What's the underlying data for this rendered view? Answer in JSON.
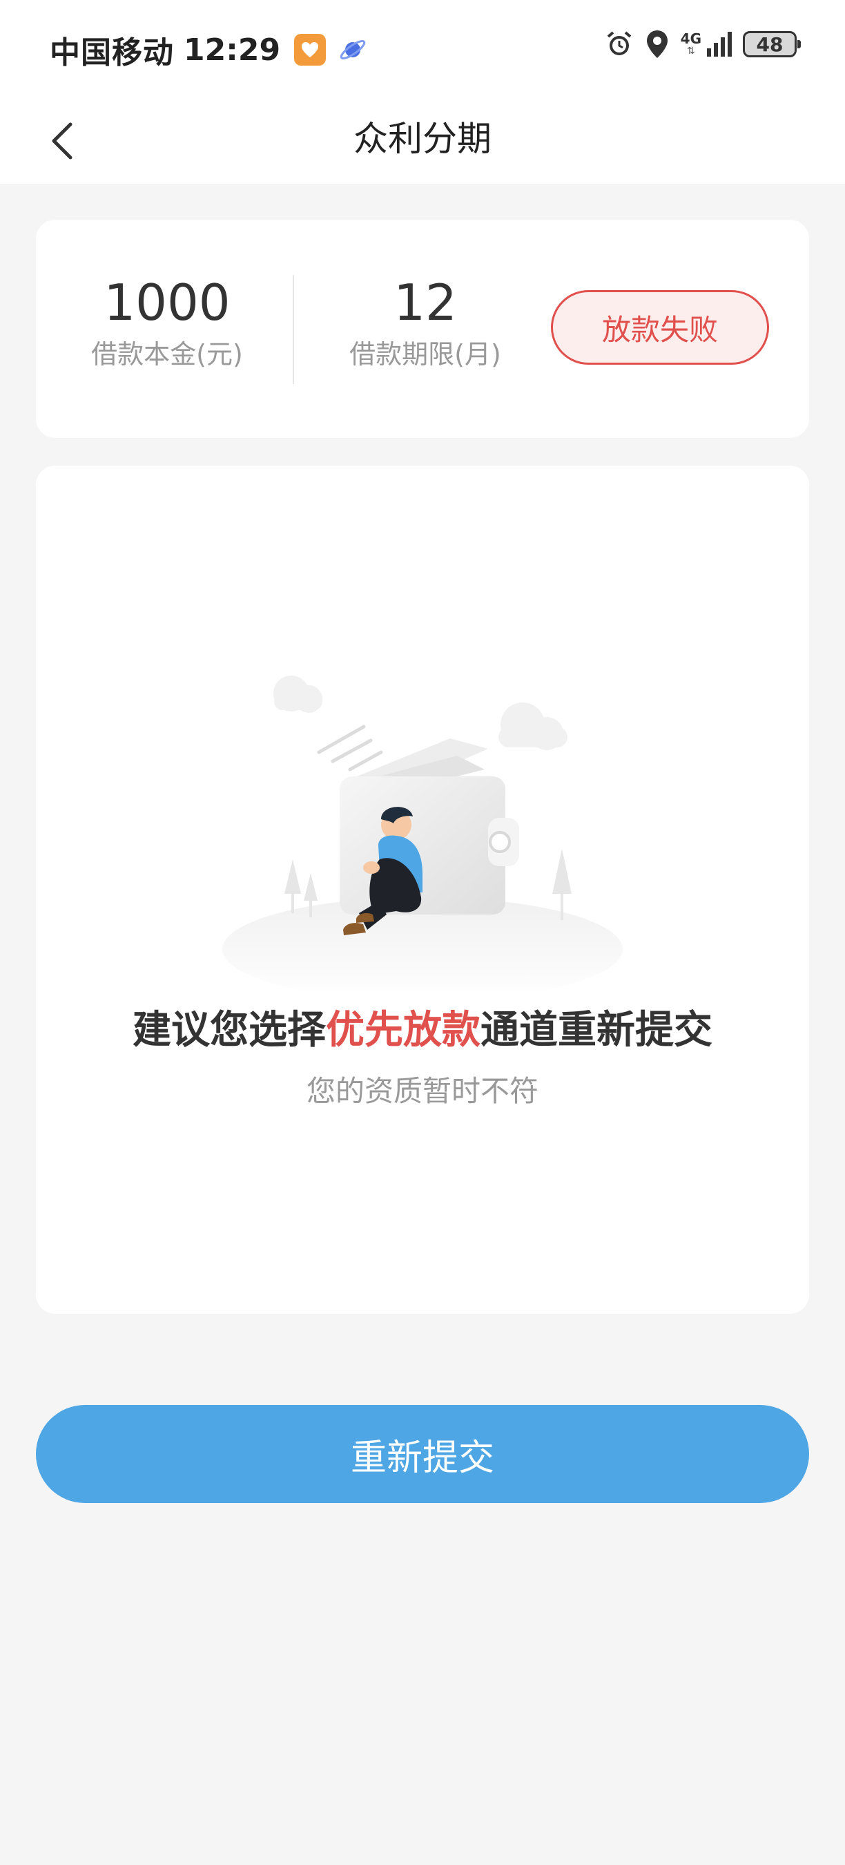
{
  "status_bar": {
    "carrier": "中国移动",
    "time": "12:29",
    "network": "4G",
    "battery": "48",
    "icons": [
      "app-heart-icon",
      "planet-icon",
      "alarm-icon",
      "location-icon",
      "signal-icon",
      "battery-icon"
    ]
  },
  "nav": {
    "title": "众利分期",
    "back_icon": "chevron-left-icon"
  },
  "summary": {
    "principal_value": "1000",
    "principal_label": "借款本金(元)",
    "term_value": "12",
    "term_label": "借款期限(月)",
    "status_label": "放款失败",
    "status_color": "#e0504c"
  },
  "result": {
    "illustration": "person-sitting-by-wallet-illustration",
    "suggest_prefix": "建议您选择",
    "suggest_highlight": "优先放款",
    "suggest_suffix": "通道重新提交",
    "reason": "您的资质暂时不符"
  },
  "action": {
    "resubmit_label": "重新提交",
    "button_color": "#4ea6e5"
  }
}
